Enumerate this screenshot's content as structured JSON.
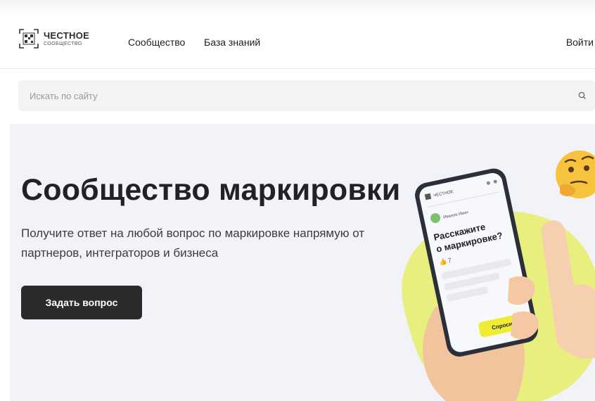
{
  "header": {
    "logo": {
      "title": "ЧЕСТНОЕ",
      "subtitle": "СООБЩЕСТВО"
    },
    "nav": [
      {
        "label": "Сообщество"
      },
      {
        "label": "База знаний"
      }
    ],
    "login_label": "Войти"
  },
  "search": {
    "placeholder": "Искать по сайту",
    "value": ""
  },
  "hero": {
    "title": "Сообщество маркировки",
    "subtitle": "Получите ответ на любой вопрос по маркировке напрямую от партнеров, интеграторов и бизнеса",
    "cta_label": "Задать вопрос"
  },
  "phone": {
    "logo_text": "ЧЕСТНОЕ",
    "user_name": "Иванов Иван",
    "question_line1": "Расскажите",
    "question_line2": "о маркировке?",
    "likes": "7",
    "button_label": "Спросить"
  },
  "colors": {
    "accent_yellow": "#e9ef7e",
    "dark_button": "#2b2b2b",
    "hero_bg": "#f1f3f8",
    "phone_button": "#f0ec34"
  },
  "icons": {
    "logo": "qr-code-logo-icon",
    "search": "search-icon",
    "emoji": "thinking-face-icon"
  }
}
